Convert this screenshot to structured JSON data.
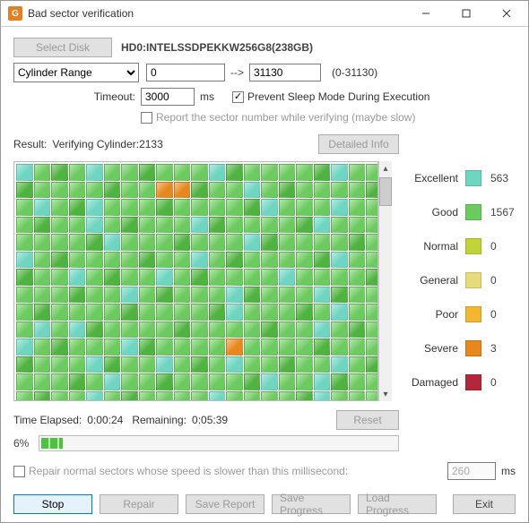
{
  "window": {
    "title": "Bad sector verification"
  },
  "toolbar": {
    "select_disk": "Select Disk",
    "disk_name": "HD0:INTELSSDPEKKW256G8(238GB)",
    "range_label": "Cylinder Range",
    "range_start": "0",
    "range_arrow": "-->",
    "range_end": "31130",
    "range_hint": "(0-31130)",
    "timeout_label": "Timeout:",
    "timeout_value": "3000",
    "timeout_unit": "ms",
    "prevent_sleep": "Prevent Sleep Mode During Execution",
    "prevent_sleep_checked": true,
    "report_sector": "Report the sector number while verifying (maybe slow)",
    "report_sector_checked": false
  },
  "result": {
    "label": "Result:",
    "status": "Verifying Cylinder:2133",
    "detailed_info": "Detailed Info"
  },
  "legend": {
    "items": [
      {
        "name": "Excellent",
        "count": "563",
        "color": "#6dd5c0"
      },
      {
        "name": "Good",
        "count": "1567",
        "color": "#6ccb5f"
      },
      {
        "name": "Normal",
        "count": "0",
        "color": "#c0d438"
      },
      {
        "name": "General",
        "count": "0",
        "color": "#e7db79"
      },
      {
        "name": "Poor",
        "count": "0",
        "color": "#f3b62f"
      },
      {
        "name": "Severe",
        "count": "3",
        "color": "#e6881d"
      },
      {
        "name": "Damaged",
        "count": "0",
        "color": "#b3273b"
      }
    ]
  },
  "footer": {
    "elapsed_label": "Time Elapsed:",
    "elapsed": "0:00:24",
    "remaining_label": "Remaining:",
    "remaining": "0:05:39",
    "reset": "Reset",
    "percent": "6%",
    "progress_pct": 6,
    "repair_normal_label": "Repair normal sectors whose speed is slower than this millisecond:",
    "repair_ms": "260",
    "repair_unit": "ms",
    "stop": "Stop",
    "repair": "Repair",
    "save_report": "Save Report",
    "save_progress": "Save Progress",
    "load_progress": "Load Progress",
    "exit": "Exit"
  },
  "grid": {
    "cols": 22,
    "rows": 14,
    "severe_cells": [
      30,
      31,
      232
    ],
    "teal_cells": [
      0,
      4,
      18,
      45,
      70,
      93,
      120,
      147,
      171,
      199,
      226,
      254,
      281,
      297,
      11,
      58,
      83,
      135,
      160,
      188,
      215,
      246,
      269,
      290,
      35,
      62,
      101,
      128,
      175,
      201,
      232,
      260,
      48,
      76,
      110,
      140,
      166,
      194,
      220,
      250,
      278,
      303
    ]
  }
}
